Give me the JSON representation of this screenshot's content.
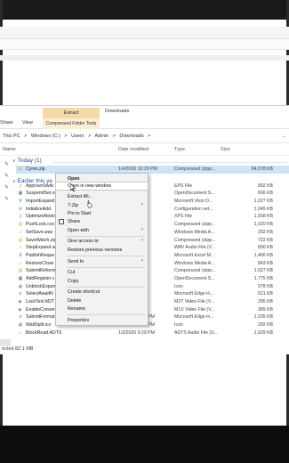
{
  "ribbon": {
    "share": "Share",
    "view": "View",
    "extract": "Extract",
    "compressed_tools": "Compressed Folder Tools",
    "downloads": "Downloads"
  },
  "address": {
    "crumbs": [
      "This PC",
      ">",
      "Windows (C:)",
      ">",
      "Users",
      ">",
      "Admin",
      ">",
      "Downloads",
      ">"
    ]
  },
  "columns": {
    "name": "Name",
    "date": "Date modified",
    "type": "Type",
    "size": "Size"
  },
  "groups": {
    "today": "Today (1)",
    "earlier": "Earlier this ye"
  },
  "files": [
    {
      "name": "Cyrex.zip",
      "date": "1/4/2026 10:29 PM",
      "type": "Compressed (zipp...",
      "size": "84,578 KB",
      "icon": "zip-icon",
      "color": "#d7b24a"
    },
    {
      "name": "ApproveSwitc",
      "date": "",
      "type": "EPS File",
      "size": "892 KB",
      "icon": "file-icon",
      "color": "#9aa0a6"
    },
    {
      "name": "SuspendSet.o",
      "date": "",
      "type": "OpenDocument S...",
      "size": "666 KB",
      "icon": "ods-icon",
      "color": "#3a8a3a"
    },
    {
      "name": "ImportExpand",
      "date": "",
      "type": "Microsoft Visio D...",
      "size": "1,027 KB",
      "icon": "visio-icon",
      "color": "#3955a3"
    },
    {
      "name": "InitializeAdd.",
      "date": "",
      "type": "Configuration set...",
      "size": "1,049 KB",
      "icon": "config-icon",
      "color": "#8a8a8a"
    },
    {
      "name": "OptimizeRedo",
      "date": "",
      "type": "XPS File",
      "size": "1,558 KB",
      "icon": "xps-icon",
      "color": "#6b7fa8"
    },
    {
      "name": "PushLock.cvs",
      "date": "",
      "type": "Compressed (zipp...",
      "size": "1,020 KB",
      "icon": "zip-icon",
      "color": "#d7b24a"
    },
    {
      "name": "SetSave.wav",
      "date": "",
      "type": "Windows Media A...",
      "size": "292 KB",
      "icon": "audio-icon",
      "color": "#5a7fbf"
    },
    {
      "name": "SaveWatch.zip",
      "date": "",
      "type": "Compressed (zipp...",
      "size": "722 KB",
      "icon": "zip-icon",
      "color": "#d7b24a"
    },
    {
      "name": "StepExpand.w",
      "date": "",
      "type": "WAV Audio File (V...",
      "size": "890 KB",
      "icon": "audio-icon",
      "color": "#5a7fbf"
    },
    {
      "name": "PublishReque",
      "date": "",
      "type": "Microsoft Excel M...",
      "size": "1,466 KB",
      "icon": "excel-icon",
      "color": "#1e7a44"
    },
    {
      "name": "RestoreClose",
      "date": "",
      "type": "Windows Media A...",
      "size": "843 KB",
      "icon": "audio-icon",
      "color": "#5a7fbf"
    },
    {
      "name": "SubmitReform",
      "date": "",
      "type": "Compressed (zipp...",
      "size": "1,027 KB",
      "icon": "zip-icon",
      "color": "#d7b24a"
    },
    {
      "name": "AddRegister.c",
      "date": "",
      "type": "OpenDocument S...",
      "size": "1,775 KB",
      "icon": "ods-icon",
      "color": "#3a8a3a"
    },
    {
      "name": "UnblockExpan",
      "date": "",
      "type": "Icon",
      "size": "978 KB",
      "icon": "image-icon",
      "color": "#9aa0a6"
    },
    {
      "name": "SelectAwaitN",
      "date": "",
      "type": "Microsoft Edge H...",
      "size": "621 KB",
      "icon": "edge-icon",
      "color": "#1f8fd6"
    },
    {
      "name": "LockTest.M2T",
      "date": "",
      "type": "M2T Video File (V...",
      "size": "295 KB",
      "icon": "video-icon",
      "color": "#8a8a8a"
    },
    {
      "name": "EnableConver",
      "date": "",
      "type": "M1V Video File (V...",
      "size": "389 KB",
      "icon": "video-icon",
      "color": "#8a8a8a"
    },
    {
      "name": "SubmitFormat",
      "date": "1/4/2026 9:29 PM",
      "type": "Microsoft Edge H...",
      "size": "1,035 KB",
      "icon": "edge-icon",
      "color": "#1f8fd6"
    },
    {
      "name": "WaitSplit.ico",
      "date": "1/4/2026 9:29 PM",
      "type": "Icon",
      "size": "292 KB",
      "icon": "image-icon",
      "color": "#9aa0a6"
    },
    {
      "name": "BlockRead.ADTS",
      "date": "1/3/2026 9:29 PM",
      "type": "ADTS Audio File (V...",
      "size": "1,029 KB",
      "icon": "audio-icon",
      "color": "#5a7fbf"
    }
  ],
  "status": "ected  82.1 MB",
  "context_menu": {
    "open": "Open",
    "open_new_window": "Open in new window",
    "extract_all": "Extract All...",
    "seven_zip": "7-Zip",
    "pin_to_start": "Pin to Start",
    "share": "Share",
    "open_with": "Open with",
    "give_access": "Give access to",
    "restore_versions": "Restore previous versions",
    "send_to": "Send to",
    "cut": "Cut",
    "copy": "Copy",
    "create_shortcut": "Create shortcut",
    "delete": "Delete",
    "rename": "Rename",
    "properties": "Properties"
  },
  "colors": {
    "selection": "#cce4f7",
    "group_text": "#1f4e99",
    "ribbon_context": "#f5d9a8"
  }
}
